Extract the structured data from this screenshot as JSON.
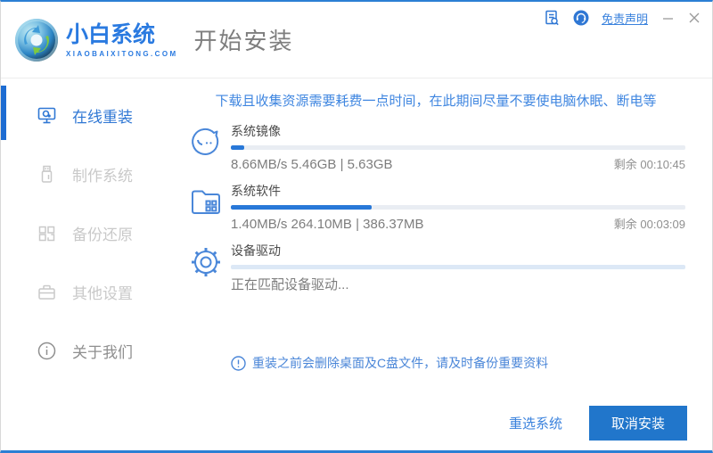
{
  "colors": {
    "accent": "#2b7fd4",
    "accent_dark": "#1d6cd2",
    "link_blue": "#3a82dd",
    "warning_blue": "#3f86e0",
    "button_blue": "#2176cb",
    "track_gray": "#e9edf3",
    "track_blue": "#dce8f6",
    "progress_fill": "#2878d8"
  },
  "header": {
    "logo_title": "小白系统",
    "logo_subtitle": "XIAOBAIXITONG.COM",
    "page_title": "开始安装",
    "disclaimer_link": "免责声明"
  },
  "sidebar": {
    "items": [
      {
        "label": "在线重装",
        "icon": "monitor-reinstall-icon",
        "active": true
      },
      {
        "label": "制作系统",
        "icon": "usb-drive-icon",
        "active": false
      },
      {
        "label": "备份还原",
        "icon": "backup-restore-icon",
        "active": false
      },
      {
        "label": "其他设置",
        "icon": "toolbox-icon",
        "active": false
      },
      {
        "label": "关于我们",
        "icon": "info-circle-icon",
        "active": false
      }
    ]
  },
  "main": {
    "warning": "下载且收集资源需要耗费一点时间，在此期间尽量不要使电脑休眠、断电等",
    "tasks": [
      {
        "name": "系统镜像",
        "icon": "mascot-face-icon",
        "stats": "8.66MB/s 5.46GB | 5.63GB",
        "remaining": "剩余 00:10:45",
        "progress_pct": 3
      },
      {
        "name": "系统软件",
        "icon": "folder-grid-icon",
        "stats": "1.40MB/s 264.10MB | 386.37MB",
        "remaining": "剩余 00:03:09",
        "progress_pct": 31
      },
      {
        "name": "设备驱动",
        "icon": "gear-icon",
        "stats": "正在匹配设备驱动...",
        "remaining": "",
        "progress_pct": 0
      }
    ],
    "note": "重装之前会删除桌面及C盘文件，请及时备份重要资料"
  },
  "footer": {
    "reselect_button": "重选系统",
    "cancel_button": "取消安装"
  }
}
